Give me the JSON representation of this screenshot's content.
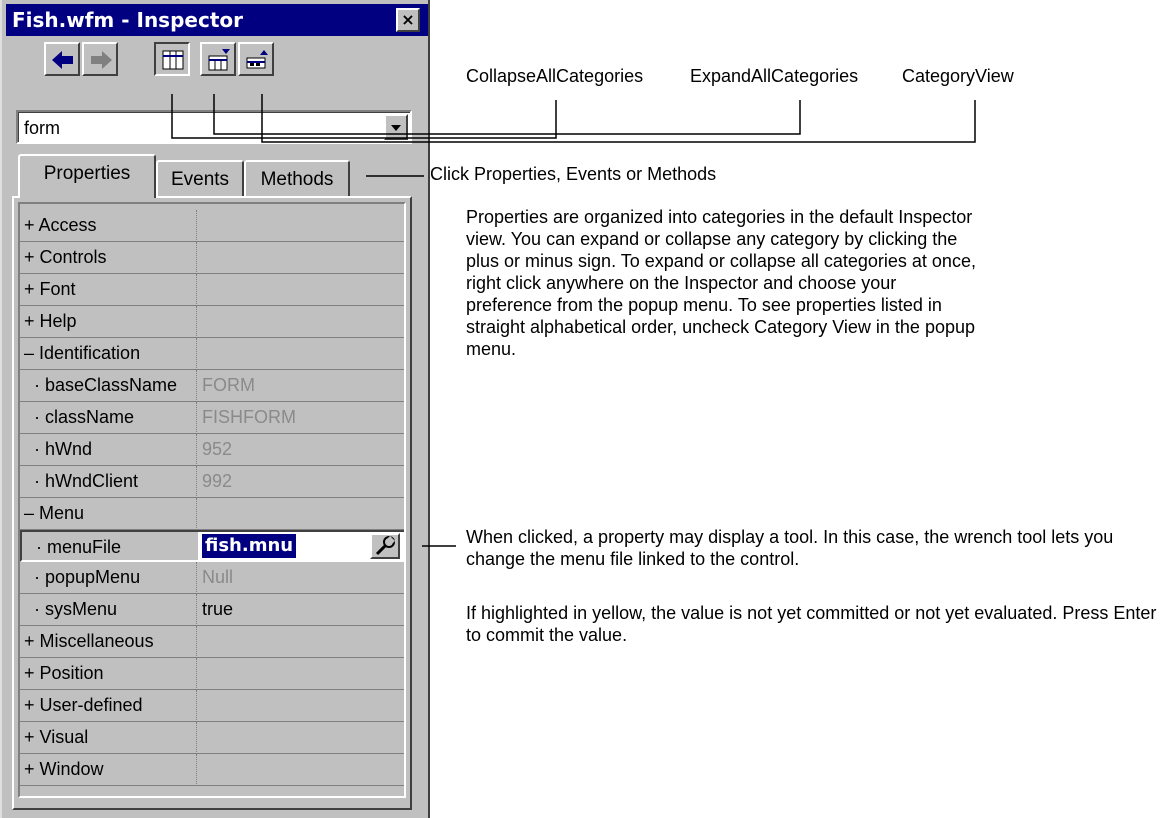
{
  "window": {
    "title": "Fish.wfm - Inspector",
    "close_glyph": "×"
  },
  "toolbar": {
    "back_icon": "back-arrow-icon",
    "forward_icon": "forward-arrow-icon",
    "category_view_icon": "category-view-icon",
    "expand_all_icon": "expand-all-icon",
    "collapse_all_icon": "collapse-all-icon"
  },
  "object_combo": {
    "value": "form"
  },
  "tabs": [
    {
      "label": "Properties"
    },
    {
      "label": "Events"
    },
    {
      "label": "Methods"
    }
  ],
  "properties": [
    {
      "name": "+ Access",
      "value": ""
    },
    {
      "name": "+ Controls",
      "value": ""
    },
    {
      "name": "+ Font",
      "value": ""
    },
    {
      "name": "+ Help",
      "value": ""
    },
    {
      "name": "– Identification",
      "value": ""
    },
    {
      "name": "  · baseClassName",
      "value": "FORM"
    },
    {
      "name": "  · className",
      "value": "FISHFORM"
    },
    {
      "name": "  · hWnd",
      "value": "952"
    },
    {
      "name": "  · hWndClient",
      "value": "992"
    },
    {
      "name": "– Menu",
      "value": ""
    },
    {
      "name": "  · menuFile",
      "value": "fish.mnu"
    },
    {
      "name": "  · popupMenu",
      "value": "Null"
    },
    {
      "name": "  · sysMenu",
      "value": "true"
    },
    {
      "name": "+ Miscellaneous",
      "value": ""
    },
    {
      "name": "+ Position",
      "value": ""
    },
    {
      "name": "+ User-defined",
      "value": ""
    },
    {
      "name": "+ Visual",
      "value": ""
    },
    {
      "name": "+ Window",
      "value": ""
    }
  ],
  "callouts": {
    "collapse_all": "CollapseAllCategories",
    "expand_all": "ExpandAllCategories",
    "category_view": "CategoryView",
    "tabs_hint": "Click Properties, Events or Methods",
    "categories_desc": "Properties are organized into categories in the default Inspector view. You can expand or collapse any category by clicking the plus or minus sign. To expand or collapse all categories at once, right click anywhere on the Inspector and choose your preference from the popup menu. To see properties listed in straight alphabetical order, uncheck Category View in the popup menu.",
    "tool_desc": "When clicked, a property may display a tool. In this case, the wrench tool lets you change the menu file linked to the control.",
    "yellow_desc": "If highlighted in yellow, the value is not yet committed or not yet evaluated. Press Enter to commit the value."
  }
}
